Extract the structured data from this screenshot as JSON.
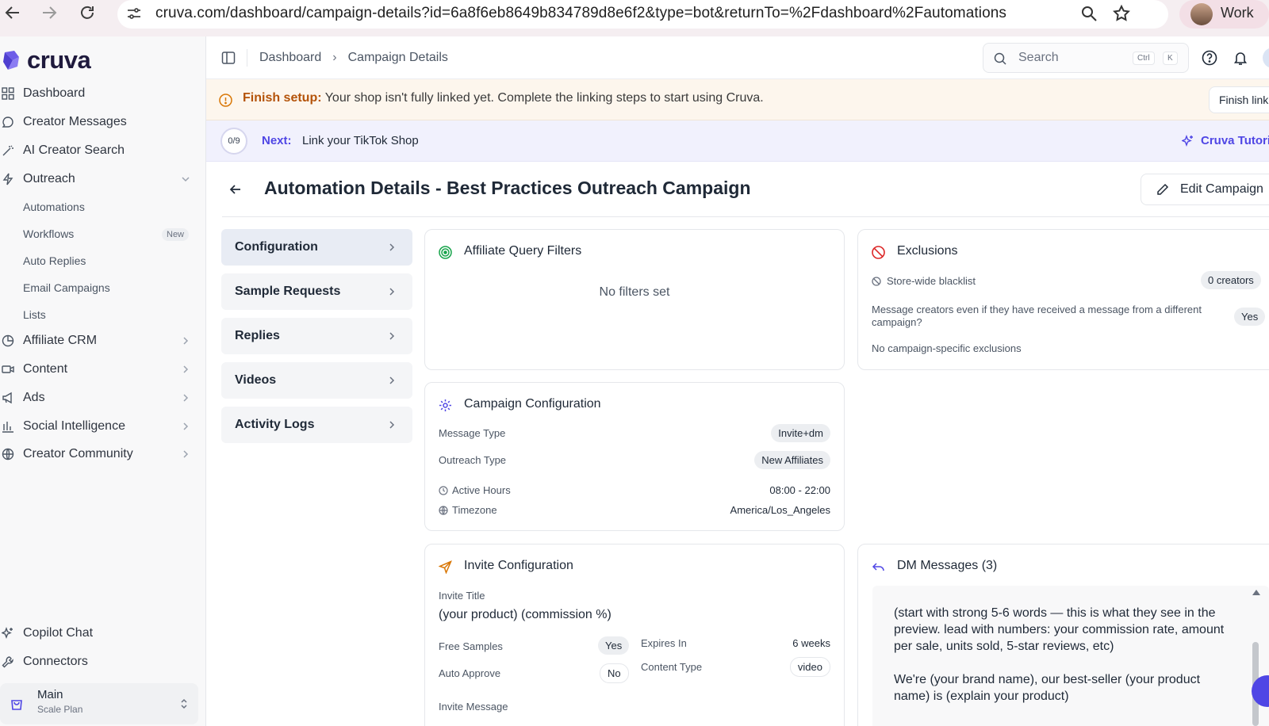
{
  "browser": {
    "url": "cruva.com/dashboard/campaign-details?id=6a8f6eb8649b834789d8e6f2&type=bot&returnTo=%2Fdashboard%2Fautomations",
    "profile_label": "Work"
  },
  "sidebar": {
    "logo_text": "cruva",
    "items": [
      {
        "label": "Dashboard",
        "icon": "grid-icon"
      },
      {
        "label": "Creator Messages",
        "icon": "chat-icon"
      },
      {
        "label": "AI Creator Search",
        "icon": "wand-icon"
      },
      {
        "label": "Outreach",
        "icon": "bolt-icon"
      },
      {
        "label": "Affiliate CRM",
        "icon": "pie-icon"
      },
      {
        "label": "Content",
        "icon": "video-icon"
      },
      {
        "label": "Ads",
        "icon": "megaphone-icon"
      },
      {
        "label": "Social Intelligence",
        "icon": "bar-chart-icon"
      },
      {
        "label": "Creator Community",
        "icon": "globe-icon"
      }
    ],
    "outreach_sub": [
      "Automations",
      "Workflows",
      "Auto Replies",
      "Email Campaigns",
      "Lists"
    ],
    "new_badge": "New",
    "bottom_items": [
      {
        "label": "Copilot Chat",
        "icon": "sparkle-icon"
      },
      {
        "label": "Connectors",
        "icon": "wrench-icon"
      }
    ],
    "plan": {
      "name": "Main",
      "sub": "Scale Plan"
    }
  },
  "topbar": {
    "breadcrumb": [
      "Dashboard",
      "Campaign Details"
    ],
    "search_placeholder": "Search",
    "kbd_ctrl": "Ctrl",
    "kbd_k": "K"
  },
  "setup_banner": {
    "bold": "Finish setup:",
    "text": " Your shop isn't fully linked yet. Complete the linking steps to start using Cruva.",
    "button": "Finish linking"
  },
  "next_banner": {
    "progress": "0/9",
    "label": "Next:",
    "task": "Link your TikTok Shop",
    "tutorial": "Cruva Tutorial"
  },
  "page": {
    "title": "Automation Details - Best Practices Outreach Campaign",
    "edit_button": "Edit Campaign"
  },
  "tabs": [
    "Configuration",
    "Sample Requests",
    "Replies",
    "Videos",
    "Activity Logs"
  ],
  "filters_card": {
    "title": "Affiliate Query Filters",
    "empty": "No filters set"
  },
  "exclusions_card": {
    "title": "Exclusions",
    "blacklist_label": "Store-wide blacklist",
    "blacklist_value": "0 creators",
    "cross_campaign_label": "Message creators even if they have received a message from a different campaign?",
    "cross_campaign_value": "Yes",
    "no_specific": "No campaign-specific exclusions"
  },
  "config_card": {
    "title": "Campaign Configuration",
    "message_type_label": "Message Type",
    "message_type_value": "Invite+dm",
    "outreach_type_label": "Outreach Type",
    "outreach_type_value": "New Affiliates",
    "active_hours_label": "Active Hours",
    "active_hours_value": "08:00 - 22:00",
    "timezone_label": "Timezone",
    "timezone_value": "America/Los_Angeles"
  },
  "invite_card": {
    "title": "Invite Configuration",
    "invite_title_label": "Invite Title",
    "invite_title_value": "(your product) (commission %)",
    "free_samples_label": "Free Samples",
    "free_samples_value": "Yes",
    "auto_approve_label": "Auto Approve",
    "auto_approve_value": "No",
    "expires_label": "Expires In",
    "expires_value": "6 weeks",
    "content_type_label": "Content Type",
    "content_type_value": "video",
    "invite_message_label": "Invite Message"
  },
  "dm_card": {
    "title": "DM Messages (3)",
    "para1": "(start with strong 5-6 words — this is what they see in the preview. lead with numbers: your commission rate, amount per sale, units sold, 5-star reviews, etc)",
    "para2": "We're (your brand name), our best-seller (your product name) is (explain your product)"
  },
  "colors": {
    "accent": "#4f46e5",
    "warning": "#b45309",
    "success": "#16a34a",
    "danger": "#dc2626"
  }
}
